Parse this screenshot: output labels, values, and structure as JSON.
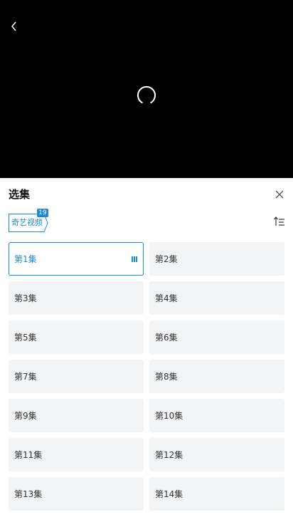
{
  "panel": {
    "title": "选集"
  },
  "source": {
    "label": "奇艺视频",
    "badge": "19"
  },
  "episodes": [
    {
      "label": "第1集",
      "active": true
    },
    {
      "label": "第2集"
    },
    {
      "label": "第3集"
    },
    {
      "label": "第4集"
    },
    {
      "label": "第5集"
    },
    {
      "label": "第6集"
    },
    {
      "label": "第7集"
    },
    {
      "label": "第8集"
    },
    {
      "label": "第9集"
    },
    {
      "label": "第10集"
    },
    {
      "label": "第11集"
    },
    {
      "label": "第12集"
    },
    {
      "label": "第13集"
    },
    {
      "label": "第14集"
    }
  ],
  "icons": {
    "back": "back-chevron-icon",
    "loading": "loading-spinner-icon",
    "close": "close-icon",
    "sort": "sort-order-icon",
    "playing": "playing-bars-icon"
  },
  "colors": {
    "accent": "#1e8bd6",
    "player_bg": "#000000",
    "tile_bg": "#f3f4f6"
  }
}
